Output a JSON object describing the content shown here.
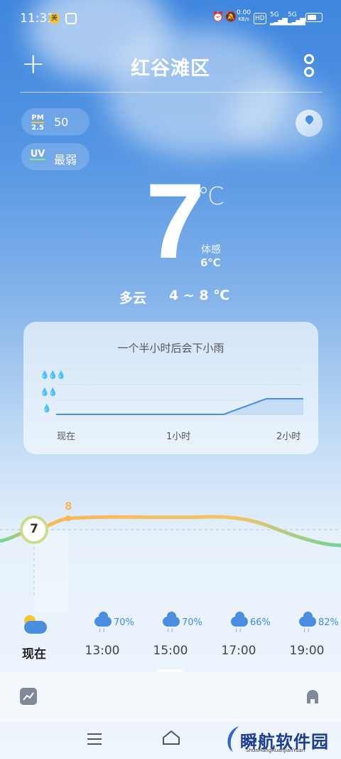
{
  "status_bar": {
    "time": "11:31",
    "net_speed": "0.00",
    "net_unit": "KB/s",
    "signal1": "5G",
    "signal2": "5G",
    "hd": "HD"
  },
  "header": {
    "city": "红谷滩区"
  },
  "air": {
    "pm_tag": "PM\n2.5",
    "pm_value": "50",
    "uv_tag": "UV",
    "uv_value": "最弱"
  },
  "current": {
    "temp": "7",
    "unit": "℃",
    "feels_label": "体感",
    "feels_value": "6℃",
    "condition": "多云",
    "range": "4 ~ 8 ℃"
  },
  "rain_card": {
    "title": "一个半小时后会下小雨",
    "x_labels": [
      "现在",
      "1小时",
      "2小时"
    ],
    "chart_data": {
      "type": "area",
      "x": [
        0,
        120
      ],
      "y_levels": [
        "小雨",
        "中雨",
        "大雨"
      ]
    }
  },
  "temp_curve": {
    "now_temp": "7",
    "peak_temp": "8"
  },
  "hourly": [
    {
      "time": "现在",
      "pct": ""
    },
    {
      "time": "13:00",
      "pct": "70%"
    },
    {
      "time": "15:00",
      "pct": "70%"
    },
    {
      "time": "17:00",
      "pct": "66%"
    },
    {
      "time": "19:00",
      "pct": "82%"
    }
  ],
  "watermark": {
    "text": "瞬航软件园",
    "sub": "ShunHangRuanJianYuan"
  },
  "colors": {
    "accent": "#4a8ee0",
    "curve_warm": "#f7b955",
    "curve_cool": "#6fd49a"
  }
}
